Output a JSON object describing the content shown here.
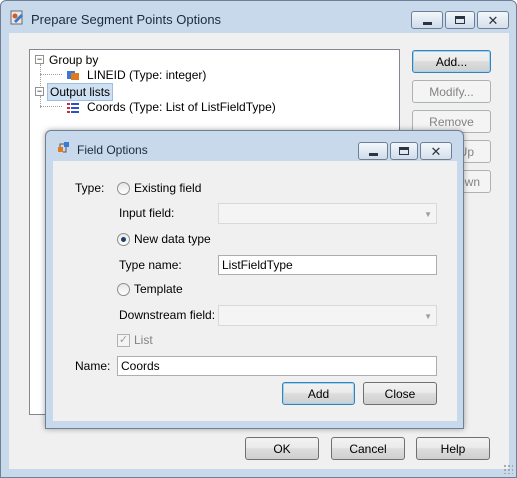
{
  "main_window": {
    "title": "Prepare Segment Points Options",
    "title_icon": "app-icon",
    "buttons": {
      "add": "Add...",
      "modify": "Modify...",
      "remove": "Remove",
      "move_up_partial": "Up",
      "move_down_partial": "own",
      "ok": "OK",
      "cancel": "Cancel",
      "help": "Help"
    }
  },
  "tree": {
    "items": [
      {
        "label": "Group by",
        "level": 0,
        "expander": "−",
        "icon": ""
      },
      {
        "label": "LINEID (Type: integer)",
        "level": 1,
        "icon": "field-node-icon"
      },
      {
        "label": "Output lists",
        "level": 0,
        "expander": "−",
        "selected": true,
        "icon": ""
      },
      {
        "label": "Coords (Type: List of ListFieldType)",
        "level": 1,
        "icon": "list-node-icon"
      }
    ]
  },
  "field_dialog": {
    "title": "Field Options",
    "type_label": "Type:",
    "existing_field_label": "Existing field",
    "input_field_label": "Input field:",
    "input_field_value": "",
    "new_data_type_label": "New data type",
    "type_name_label": "Type name:",
    "type_name_value": "ListFieldType",
    "template_label": "Template",
    "downstream_field_label": "Downstream field:",
    "downstream_field_value": "",
    "list_label": "List",
    "list_checked": true,
    "name_label": "Name:",
    "name_value": "Coords",
    "selected_type": "New data type",
    "add_button": "Add",
    "close_button": "Close"
  },
  "colors": {
    "frame": "#c9d9ec",
    "client": "#f0f0f0",
    "selection": "#cfe0f3",
    "default_button_border": "#3c7fb1"
  }
}
